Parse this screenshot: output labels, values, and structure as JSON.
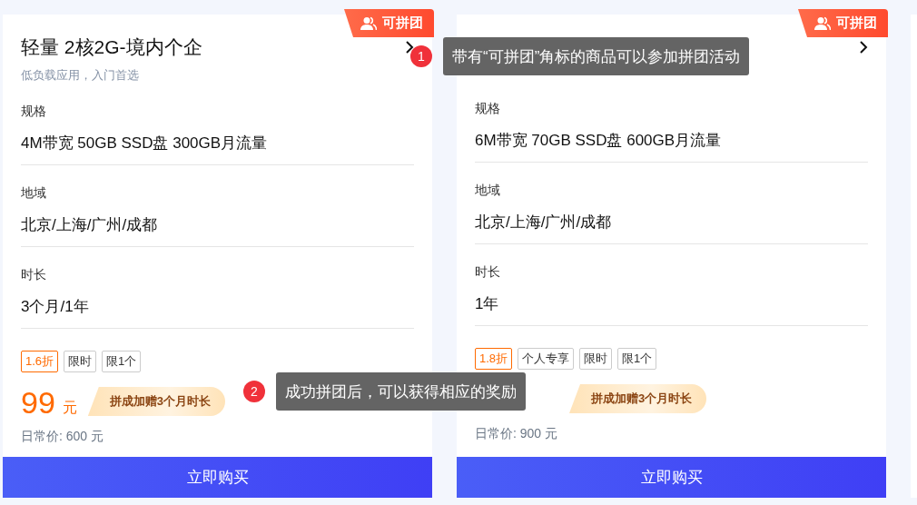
{
  "cards": [
    {
      "badge": "可拼团",
      "title": "轻量 2核2G-境内个企",
      "subtitle": "低负载应用，入门首选",
      "specs": [
        {
          "label": "规格",
          "value": "4M带宽 50GB SSD盘 300GB月流量"
        },
        {
          "label": "地域",
          "value": "北京/上海/广州/成都"
        },
        {
          "label": "时长",
          "value": "3个月/1年"
        }
      ],
      "tags": [
        {
          "kind": "discount",
          "text": "1.6折"
        },
        {
          "kind": "plain",
          "text": "限时"
        },
        {
          "kind": "plain",
          "text": "限1个"
        }
      ],
      "price": "99",
      "price_unit": "元",
      "promo": "拼成加赠3个月时长",
      "regular_price": "日常价: 600 元",
      "buy_button": "立即购买"
    },
    {
      "badge": "可拼团",
      "specs": [
        {
          "label": "规格",
          "value": "6M带宽 70GB SSD盘 600GB月流量"
        },
        {
          "label": "地域",
          "value": "北京/上海/广州/成都"
        },
        {
          "label": "时长",
          "value": "1年"
        }
      ],
      "tags": [
        {
          "kind": "discount",
          "text": "1.8折"
        },
        {
          "kind": "plain",
          "text": "个人专享"
        },
        {
          "kind": "plain",
          "text": "限时"
        },
        {
          "kind": "plain",
          "text": "限1个"
        }
      ],
      "promo": "拼成加赠3个月时长",
      "regular_price": "日常价: 900 元",
      "buy_button": "立即购买"
    }
  ],
  "guide_tips": [
    {
      "number": "1",
      "text": "带有“可拼团”角标的商品可以参加拼团活动"
    },
    {
      "number": "2",
      "text": "成功拼团后，可以获得相应的奖励"
    }
  ]
}
